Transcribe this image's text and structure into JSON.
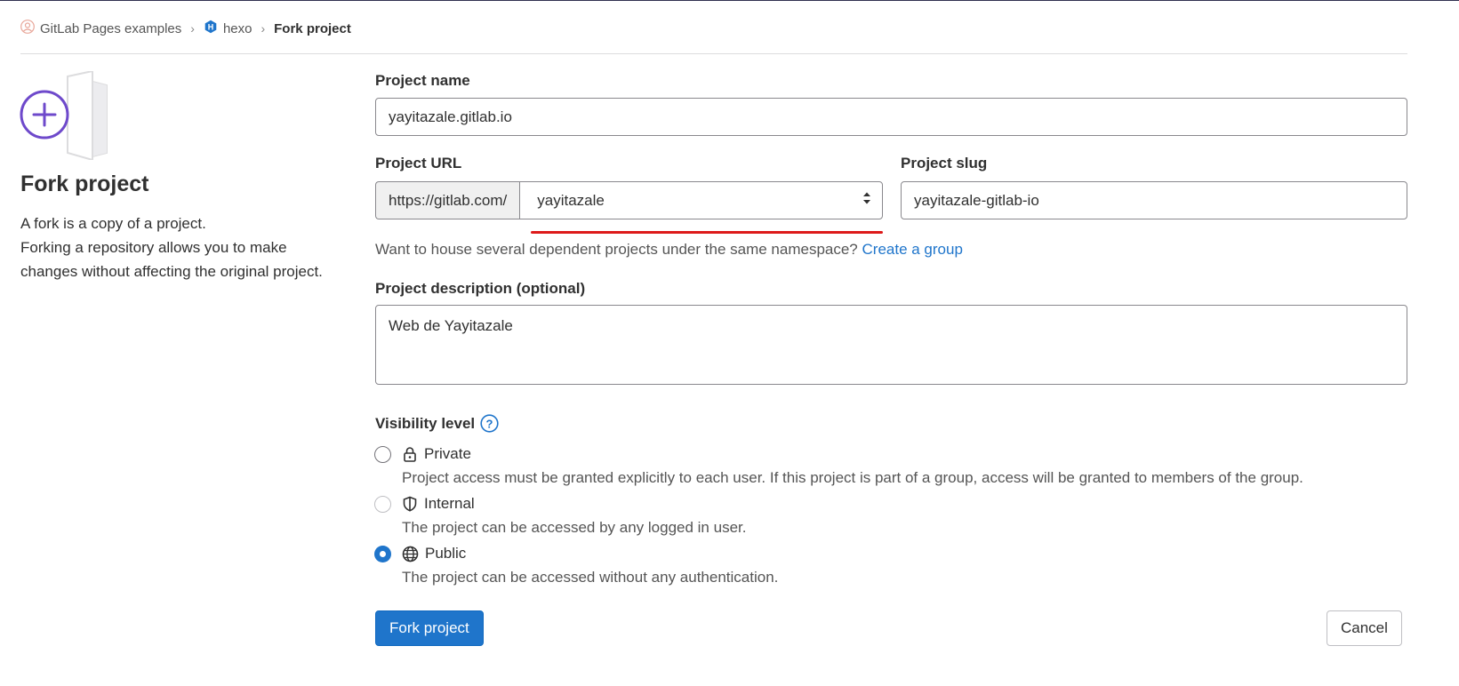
{
  "breadcrumb": {
    "items": [
      {
        "label": "GitLab Pages examples",
        "icon": "group-avatar-icon"
      },
      {
        "label": "hexo",
        "icon": "hexo-project-icon"
      },
      {
        "label": "Fork project"
      }
    ]
  },
  "sidebar": {
    "title": "Fork project",
    "description_lines": [
      "A fork is a copy of a project.",
      "Forking a repository allows you to make",
      "changes without affecting the original project."
    ]
  },
  "form": {
    "project_name": {
      "label": "Project name",
      "value": "yayitazale.gitlab.io"
    },
    "project_url": {
      "label": "Project URL",
      "prefix": "https://gitlab.com/",
      "namespace": "yayitazale"
    },
    "project_slug": {
      "label": "Project slug",
      "value": "yayitazale-gitlab-io"
    },
    "namespace_hint": {
      "text": "Want to house several dependent projects under the same namespace?",
      "link": "Create a group"
    },
    "description": {
      "label": "Project description (optional)",
      "value": "Web de Yayitazale"
    },
    "visibility": {
      "label": "Visibility level",
      "selected": "Public",
      "options": [
        {
          "label": "Private",
          "icon": "lock-icon",
          "help": "Project access must be granted explicitly to each user. If this project is part of a group, access will be granted to members of the group."
        },
        {
          "label": "Internal",
          "icon": "shield-icon",
          "help": "The project can be accessed by any logged in user."
        },
        {
          "label": "Public",
          "icon": "globe-icon",
          "help": "The project can be accessed without any authentication."
        }
      ]
    }
  },
  "actions": {
    "submit_label": "Fork project",
    "cancel_label": "Cancel"
  },
  "colors": {
    "primary": "#1f75cb",
    "annotation": "#dd1a1a",
    "illustration": "#6e49cb"
  }
}
